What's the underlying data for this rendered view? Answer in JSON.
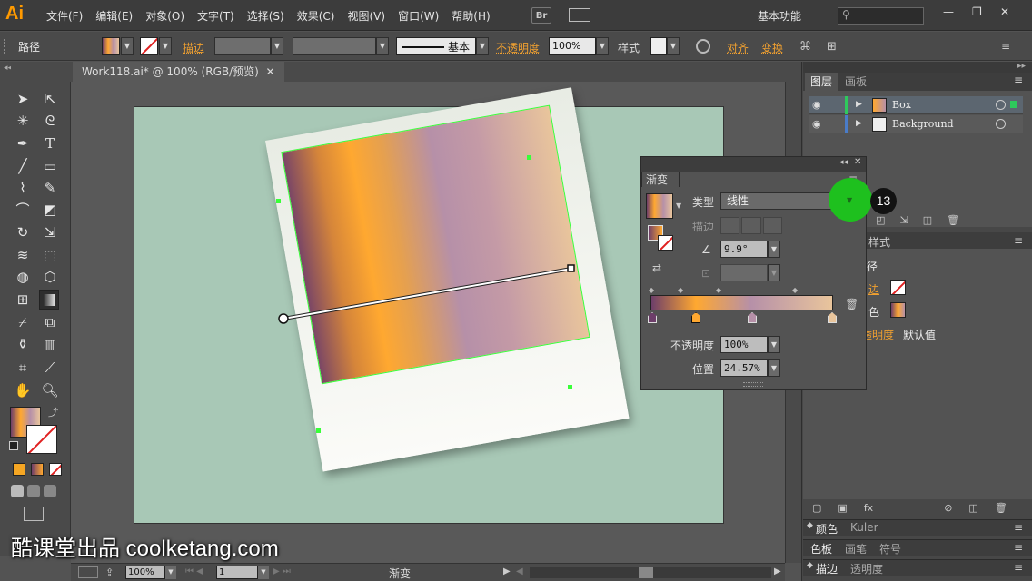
{
  "app": {
    "logo": "Ai",
    "menus": [
      "文件(F)",
      "编辑(E)",
      "对象(O)",
      "文字(T)",
      "选择(S)",
      "效果(C)",
      "视图(V)",
      "窗口(W)",
      "帮助(H)"
    ],
    "bridge": "Br",
    "workspace": "基本功能",
    "window_controls": [
      "—",
      "❐",
      "✕"
    ]
  },
  "control": {
    "object_type": "路径",
    "stroke_label": "描边",
    "stroke_style": "基本",
    "opacity_label": "不透明度",
    "opacity_value": "100%",
    "style_label": "样式",
    "align_label": "对齐",
    "transform_label": "变换"
  },
  "document": {
    "tab": "Work118.ai* @ 100% (RGB/预览)",
    "close": "✕"
  },
  "layers_panel": {
    "tabs": [
      "图层",
      "画板"
    ],
    "layers": [
      {
        "name": "Box",
        "color": "#2ec95c"
      },
      {
        "name": "Background",
        "color": "#4a7cc8"
      }
    ]
  },
  "gradient_panel": {
    "tab": "渐变",
    "type_label": "类型",
    "type_value": "线性",
    "stroke_label": "描边",
    "angle_value": "9.9°",
    "opacity_label": "不透明度",
    "opacity_value": "100%",
    "location_label": "位置",
    "location_value": "24.57%",
    "colors": {
      "stop1": "#6d3e6a",
      "stop2": "#ffa830",
      "stop3": "#b690a8",
      "stop4": "#e9c59c"
    }
  },
  "appearance_panel": {
    "tab_partial": "样式",
    "path_label": "径",
    "stroke_label": "边",
    "fill_label": "色",
    "opacity_label": "透明度",
    "opacity_value": "默认值"
  },
  "bottom_panels": {
    "group1": [
      "颜色",
      "Kuler"
    ],
    "group2": [
      "色板",
      "画笔",
      "符号"
    ],
    "group3": [
      "描边",
      "透明度"
    ]
  },
  "status": {
    "zoom": "100%",
    "page": "1",
    "tool": "渐变"
  },
  "annotation": {
    "step": "13"
  },
  "watermark": "酷课堂出品 coolketang.com"
}
